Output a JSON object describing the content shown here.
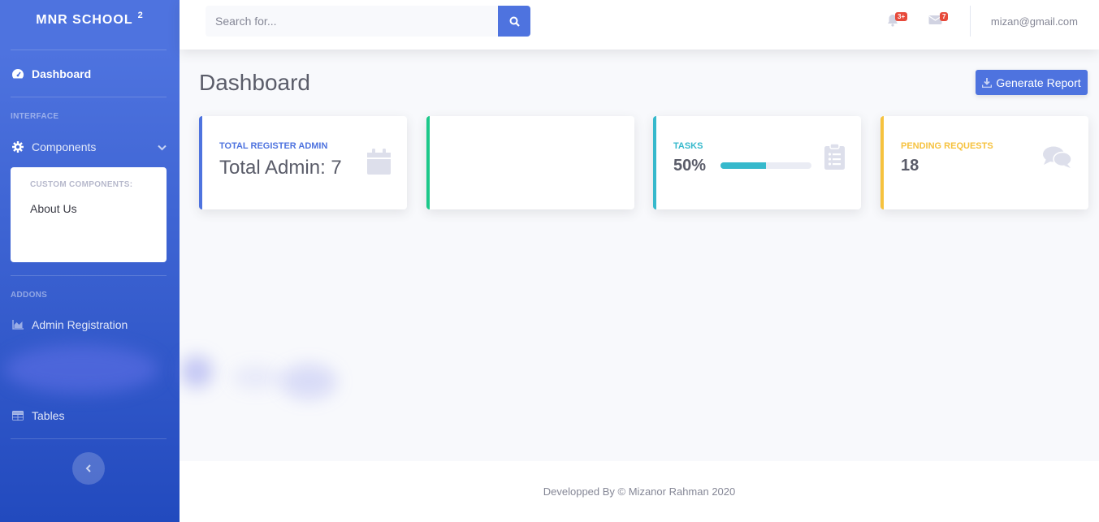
{
  "brand": {
    "name": "MNR SCHOOL",
    "sup": "2"
  },
  "sidebar": {
    "dashboard": "Dashboard",
    "heading_interface": "INTERFACE",
    "components": "Components",
    "collapse_header": "CUSTOM COMPONENTS:",
    "collapse_items": [
      "About Us"
    ],
    "heading_addons": "ADDONS",
    "admin_registration": "Admin Registration",
    "tables": "Tables"
  },
  "topbar": {
    "search_placeholder": "Search for...",
    "alerts_badge": "3+",
    "messages_badge": "7",
    "user_email": "mizan@gmail.com"
  },
  "main": {
    "title": "Dashboard",
    "report_button": "Generate Report"
  },
  "cards": [
    {
      "label": "TOTAL REGISTER ADMIN",
      "value": "Total Admin: 7",
      "color": "#4e73df",
      "icon": "calendar-icon"
    },
    {
      "label": "",
      "value": "",
      "color": "#1cc88a",
      "icon": ""
    },
    {
      "label": "TASKS",
      "value": "50%",
      "progress": 0.5,
      "color": "#36b9cc",
      "icon": "clipboard-list-icon"
    },
    {
      "label": "PENDING REQUESTS",
      "value": "18",
      "color": "#f6c23e",
      "icon": "comments-icon"
    }
  ],
  "footer": {
    "text": "Developped By © Mizanor Rahman 2020"
  }
}
